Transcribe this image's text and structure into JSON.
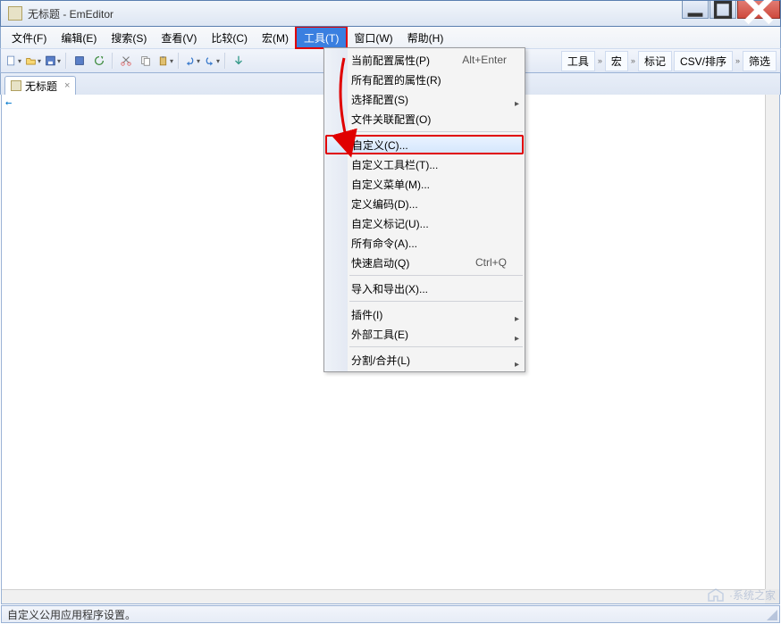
{
  "window": {
    "title": "无标题 - EmEditor"
  },
  "menubar": {
    "items": [
      {
        "label": "文件(F)"
      },
      {
        "label": "编辑(E)"
      },
      {
        "label": "搜索(S)"
      },
      {
        "label": "查看(V)"
      },
      {
        "label": "比较(C)"
      },
      {
        "label": "宏(M)"
      },
      {
        "label": "工具(T)",
        "active": true
      },
      {
        "label": "窗口(W)"
      },
      {
        "label": "帮助(H)"
      }
    ]
  },
  "toolbar_right": {
    "tools_label": "工具",
    "macro_label": "宏",
    "marks_label": "标记",
    "csv_label": "CSV/排序",
    "filter_label": "筛选"
  },
  "tabs": {
    "items": [
      {
        "label": "无标题"
      }
    ]
  },
  "editor": {
    "eof_marker": "←"
  },
  "dropdown": {
    "items": [
      {
        "label": "当前配置属性(P)",
        "shortcut": "Alt+Enter"
      },
      {
        "label": "所有配置的属性(R)"
      },
      {
        "label": "选择配置(S)",
        "submenu": true
      },
      {
        "label": "文件关联配置(O)"
      },
      {
        "sep": true
      },
      {
        "label": "自定义(C)...",
        "hover": true,
        "annot": true
      },
      {
        "label": "自定义工具栏(T)..."
      },
      {
        "label": "自定义菜单(M)..."
      },
      {
        "label": "定义编码(D)..."
      },
      {
        "label": "自定义标记(U)..."
      },
      {
        "label": "所有命令(A)..."
      },
      {
        "label": "快速启动(Q)",
        "shortcut": "Ctrl+Q"
      },
      {
        "sep": true
      },
      {
        "label": "导入和导出(X)..."
      },
      {
        "sep": true
      },
      {
        "label": "插件(I)",
        "submenu": true
      },
      {
        "label": "外部工具(E)",
        "submenu": true
      },
      {
        "sep": true
      },
      {
        "label": "分割/合并(L)",
        "submenu": true
      }
    ]
  },
  "statusbar": {
    "text": "自定义公用应用程序设置。"
  },
  "watermark": {
    "text": "·系统之家"
  }
}
